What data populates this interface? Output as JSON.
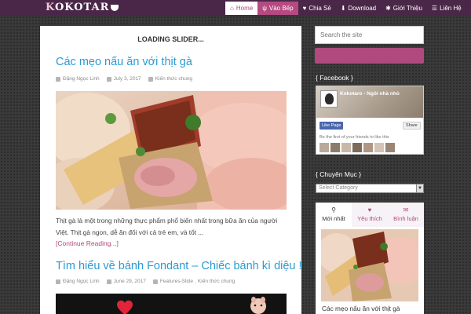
{
  "site": {
    "logo_text": "KOKOTARO"
  },
  "nav": [
    {
      "label": "Home",
      "icon": "home-icon",
      "glyph": "⌂",
      "state": "active"
    },
    {
      "label": "Vào Bếp",
      "icon": "cutlery-icon",
      "glyph": "ψ",
      "state": "pink"
    },
    {
      "label": "Chia Sẻ",
      "icon": "heart-icon",
      "glyph": "♥",
      "state": ""
    },
    {
      "label": "Download",
      "icon": "download-icon",
      "glyph": "⬇",
      "state": ""
    },
    {
      "label": "Giới Thiệu",
      "icon": "asterisk-icon",
      "glyph": "✱",
      "state": ""
    },
    {
      "label": "Liên Hệ",
      "icon": "list-icon",
      "glyph": "☰",
      "state": ""
    }
  ],
  "main": {
    "loading": "LOADING SLIDER...",
    "posts": [
      {
        "title": "Các mẹo nấu ăn với thịt gà",
        "author": "Đặng Ngọc Linh",
        "date": "July 3, 2017",
        "categories": [
          "Kiến thức chung"
        ],
        "excerpt": "Thịt gà là một trong những thực phẩm phổ biến nhất trong bữa ăn của người Việt. Thịt gà ngon, dễ ăn đối với cả trẻ em, và tốt ...",
        "readmore": "[Continue Reading...]"
      },
      {
        "title": "Tìm hiểu về bánh Fondant – Chiếc bánh kì diệu !",
        "author": "Đặng Ngọc Linh",
        "date": "June 29, 2017",
        "categories": [
          "Features-Slide",
          "Kiến thức chung"
        ]
      }
    ]
  },
  "sidebar": {
    "search_placeholder": "Search the site",
    "facebook": {
      "title": "{ Facebook }",
      "page_name": "Kokotaro - Ngôi nhà nhỏ",
      "like": "Like Page",
      "share": "Share",
      "friends_text": "Be the first of your friends to like this"
    },
    "categories": {
      "title": "{ Chuyên Mục }",
      "select": "Select Category"
    },
    "tabs": [
      {
        "label": "Mới nhất",
        "icon": "bell-icon",
        "glyph": "🔔"
      },
      {
        "label": "Yêu thích",
        "icon": "heart-icon",
        "glyph": "♥"
      },
      {
        "label": "Bình luận",
        "icon": "comment-icon",
        "glyph": "✉"
      }
    ],
    "tab_post_title": "Các mẹo nấu ăn với thịt gà"
  },
  "colors": {
    "accent": "#b04a7e",
    "link": "#2a9bd4",
    "topbar": "#4a2748"
  }
}
